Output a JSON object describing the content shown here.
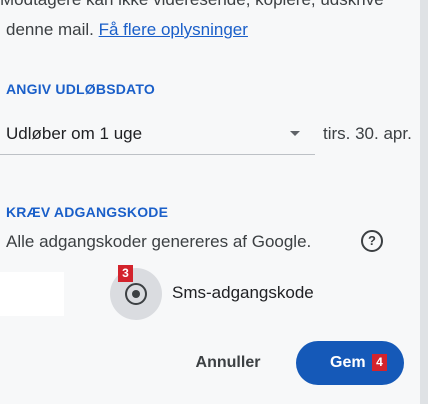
{
  "intro": {
    "cut_text": "Modtagere kan ikke videresende, kopiere, udskrive",
    "line_text": "denne mail.",
    "link_text": "Få flere oplysninger"
  },
  "expiry": {
    "heading": "ANGIV UDLØBSDATO",
    "selected": "Udløber om 1 uge",
    "date": "tirs. 30. apr."
  },
  "password": {
    "heading": "KRÆV ADGANGSKODE",
    "description": "Alle adgangskoder genereres af Google.",
    "help_icon": "?",
    "option_label": "Sms-adgangskode",
    "option_selected": true
  },
  "actions": {
    "cancel_label": "Annuller",
    "save_label": "Gem"
  },
  "badges": {
    "sms_marker": "3",
    "save_marker": "4"
  },
  "colors": {
    "accent": "#1a5fc9",
    "primary_button": "#1559b8",
    "badge": "#d3232c"
  }
}
